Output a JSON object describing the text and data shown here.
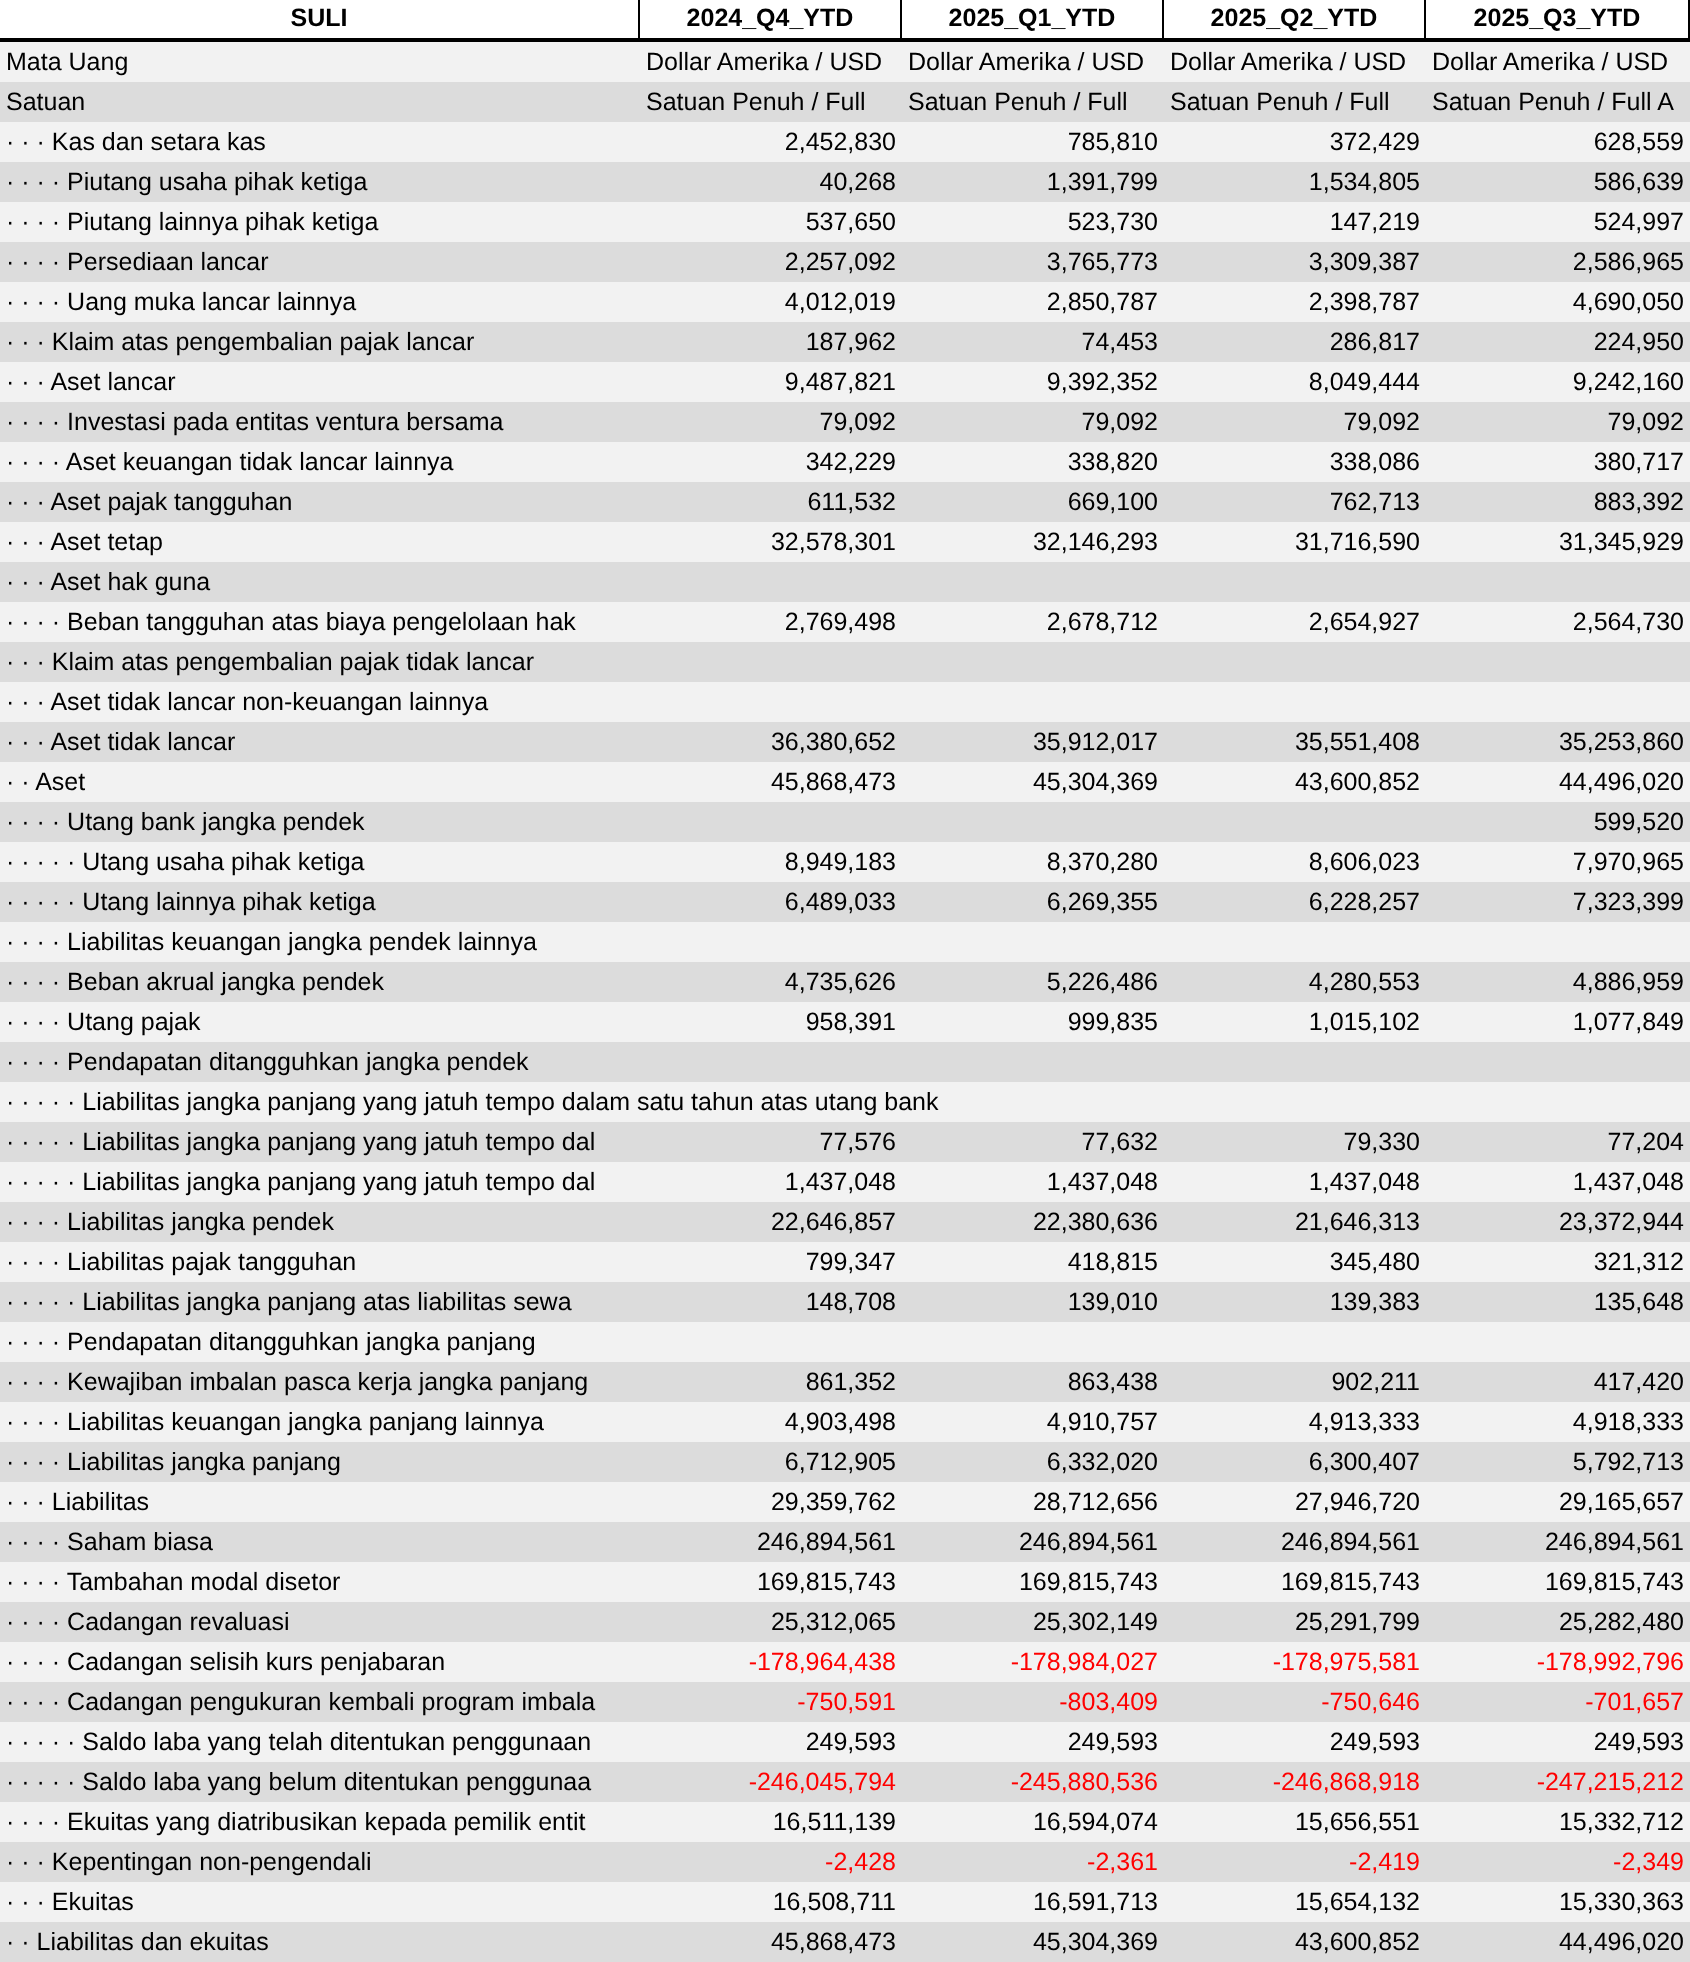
{
  "table": {
    "label_header": "SULI",
    "columns": [
      "2024_Q4_YTD",
      "2025_Q1_YTD",
      "2025_Q2_YTD",
      "2025_Q3_YTD"
    ],
    "rows": [
      {
        "label": "Mata Uang",
        "cells": [
          {
            "kind": "text",
            "text": "Dollar Amerika / USD"
          },
          {
            "kind": "text",
            "text": "Dollar Amerika / USD"
          },
          {
            "kind": "text",
            "text": "Dollar Amerika / USD"
          },
          {
            "kind": "text",
            "text": "Dollar Amerika / USD"
          }
        ]
      },
      {
        "label": "Satuan",
        "cells": [
          {
            "kind": "text",
            "text": "Satuan Penuh / Full"
          },
          {
            "kind": "text",
            "text": "Satuan Penuh / Full"
          },
          {
            "kind": "text",
            "text": "Satuan Penuh / Full"
          },
          {
            "kind": "text",
            "text": "Satuan Penuh / Full A"
          }
        ]
      },
      {
        "label": "· · · Kas dan setara kas",
        "cells": [
          {
            "kind": "amount",
            "text": "2,452,830",
            "negative": false
          },
          {
            "kind": "amount",
            "text": "785,810",
            "negative": false
          },
          {
            "kind": "amount",
            "text": "372,429",
            "negative": false
          },
          {
            "kind": "amount",
            "text": "628,559",
            "negative": false
          }
        ]
      },
      {
        "label": "· · · · Piutang usaha pihak ketiga",
        "cells": [
          {
            "kind": "amount",
            "text": "40,268",
            "negative": false
          },
          {
            "kind": "amount",
            "text": "1,391,799",
            "negative": false
          },
          {
            "kind": "amount",
            "text": "1,534,805",
            "negative": false
          },
          {
            "kind": "amount",
            "text": "586,639",
            "negative": false
          }
        ]
      },
      {
        "label": "· · · · Piutang lainnya pihak ketiga",
        "cells": [
          {
            "kind": "amount",
            "text": "537,650",
            "negative": false
          },
          {
            "kind": "amount",
            "text": "523,730",
            "negative": false
          },
          {
            "kind": "amount",
            "text": "147,219",
            "negative": false
          },
          {
            "kind": "amount",
            "text": "524,997",
            "negative": false
          }
        ]
      },
      {
        "label": "· · · · Persediaan lancar",
        "cells": [
          {
            "kind": "amount",
            "text": "2,257,092",
            "negative": false
          },
          {
            "kind": "amount",
            "text": "3,765,773",
            "negative": false
          },
          {
            "kind": "amount",
            "text": "3,309,387",
            "negative": false
          },
          {
            "kind": "amount",
            "text": "2,586,965",
            "negative": false
          }
        ]
      },
      {
        "label": "· · · · Uang muka lancar lainnya",
        "cells": [
          {
            "kind": "amount",
            "text": "4,012,019",
            "negative": false
          },
          {
            "kind": "amount",
            "text": "2,850,787",
            "negative": false
          },
          {
            "kind": "amount",
            "text": "2,398,787",
            "negative": false
          },
          {
            "kind": "amount",
            "text": "4,690,050",
            "negative": false
          }
        ]
      },
      {
        "label": "· · · Klaim atas pengembalian pajak lancar",
        "cells": [
          {
            "kind": "amount",
            "text": "187,962",
            "negative": false
          },
          {
            "kind": "amount",
            "text": "74,453",
            "negative": false
          },
          {
            "kind": "amount",
            "text": "286,817",
            "negative": false
          },
          {
            "kind": "amount",
            "text": "224,950",
            "negative": false
          }
        ]
      },
      {
        "label": "· · · Aset lancar",
        "cells": [
          {
            "kind": "amount",
            "text": "9,487,821",
            "negative": false
          },
          {
            "kind": "amount",
            "text": "9,392,352",
            "negative": false
          },
          {
            "kind": "amount",
            "text": "8,049,444",
            "negative": false
          },
          {
            "kind": "amount",
            "text": "9,242,160",
            "negative": false
          }
        ]
      },
      {
        "label": "· · · · Investasi pada entitas ventura bersama",
        "cells": [
          {
            "kind": "amount",
            "text": "79,092",
            "negative": false
          },
          {
            "kind": "amount",
            "text": "79,092",
            "negative": false
          },
          {
            "kind": "amount",
            "text": "79,092",
            "negative": false
          },
          {
            "kind": "amount",
            "text": "79,092",
            "negative": false
          }
        ]
      },
      {
        "label": "· · · · Aset keuangan tidak lancar lainnya",
        "cells": [
          {
            "kind": "amount",
            "text": "342,229",
            "negative": false
          },
          {
            "kind": "amount",
            "text": "338,820",
            "negative": false
          },
          {
            "kind": "amount",
            "text": "338,086",
            "negative": false
          },
          {
            "kind": "amount",
            "text": "380,717",
            "negative": false
          }
        ]
      },
      {
        "label": "· · · Aset pajak tangguhan",
        "cells": [
          {
            "kind": "amount",
            "text": "611,532",
            "negative": false
          },
          {
            "kind": "amount",
            "text": "669,100",
            "negative": false
          },
          {
            "kind": "amount",
            "text": "762,713",
            "negative": false
          },
          {
            "kind": "amount",
            "text": "883,392",
            "negative": false
          }
        ]
      },
      {
        "label": "· · · Aset tetap",
        "cells": [
          {
            "kind": "amount",
            "text": "32,578,301",
            "negative": false
          },
          {
            "kind": "amount",
            "text": "32,146,293",
            "negative": false
          },
          {
            "kind": "amount",
            "text": "31,716,590",
            "negative": false
          },
          {
            "kind": "amount",
            "text": "31,345,929",
            "negative": false
          }
        ]
      },
      {
        "label": "· · · Aset hak guna",
        "cells": [
          {
            "kind": "blank"
          },
          {
            "kind": "blank"
          },
          {
            "kind": "blank"
          },
          {
            "kind": "blank"
          }
        ]
      },
      {
        "label": "· · · · Beban tangguhan atas biaya pengelolaan hak",
        "cells": [
          {
            "kind": "amount",
            "text": "2,769,498",
            "negative": false
          },
          {
            "kind": "amount",
            "text": "2,678,712",
            "negative": false
          },
          {
            "kind": "amount",
            "text": "2,654,927",
            "negative": false
          },
          {
            "kind": "amount",
            "text": "2,564,730",
            "negative": false
          }
        ]
      },
      {
        "label": "· · · Klaim atas pengembalian pajak tidak lancar",
        "cells": [
          {
            "kind": "blank"
          },
          {
            "kind": "blank"
          },
          {
            "kind": "blank"
          },
          {
            "kind": "blank"
          }
        ]
      },
      {
        "label": "· · · Aset tidak lancar non-keuangan lainnya",
        "cells": [
          {
            "kind": "blank"
          },
          {
            "kind": "blank"
          },
          {
            "kind": "blank"
          },
          {
            "kind": "blank"
          }
        ]
      },
      {
        "label": "· · · Aset tidak lancar",
        "cells": [
          {
            "kind": "amount",
            "text": "36,380,652",
            "negative": false
          },
          {
            "kind": "amount",
            "text": "35,912,017",
            "negative": false
          },
          {
            "kind": "amount",
            "text": "35,551,408",
            "negative": false
          },
          {
            "kind": "amount",
            "text": "35,253,860",
            "negative": false
          }
        ]
      },
      {
        "label": "· · Aset",
        "cells": [
          {
            "kind": "amount",
            "text": "45,868,473",
            "negative": false
          },
          {
            "kind": "amount",
            "text": "45,304,369",
            "negative": false
          },
          {
            "kind": "amount",
            "text": "43,600,852",
            "negative": false
          },
          {
            "kind": "amount",
            "text": "44,496,020",
            "negative": false
          }
        ]
      },
      {
        "label": "· · · · Utang bank jangka pendek",
        "cells": [
          {
            "kind": "blank"
          },
          {
            "kind": "blank"
          },
          {
            "kind": "blank"
          },
          {
            "kind": "amount",
            "text": "599,520",
            "negative": false
          }
        ]
      },
      {
        "label": "· · · · · Utang usaha pihak ketiga",
        "cells": [
          {
            "kind": "amount",
            "text": "8,949,183",
            "negative": false
          },
          {
            "kind": "amount",
            "text": "8,370,280",
            "negative": false
          },
          {
            "kind": "amount",
            "text": "8,606,023",
            "negative": false
          },
          {
            "kind": "amount",
            "text": "7,970,965",
            "negative": false
          }
        ]
      },
      {
        "label": "· · · · · Utang lainnya pihak ketiga",
        "cells": [
          {
            "kind": "amount",
            "text": "6,489,033",
            "negative": false
          },
          {
            "kind": "amount",
            "text": "6,269,355",
            "negative": false
          },
          {
            "kind": "amount",
            "text": "6,228,257",
            "negative": false
          },
          {
            "kind": "amount",
            "text": "7,323,399",
            "negative": false
          }
        ]
      },
      {
        "label": "· · · · Liabilitas keuangan jangka pendek lainnya",
        "cells": [
          {
            "kind": "blank"
          },
          {
            "kind": "blank"
          },
          {
            "kind": "blank"
          },
          {
            "kind": "blank"
          }
        ]
      },
      {
        "label": "· · · · Beban akrual jangka pendek",
        "cells": [
          {
            "kind": "amount",
            "text": "4,735,626",
            "negative": false
          },
          {
            "kind": "amount",
            "text": "5,226,486",
            "negative": false
          },
          {
            "kind": "amount",
            "text": "4,280,553",
            "negative": false
          },
          {
            "kind": "amount",
            "text": "4,886,959",
            "negative": false
          }
        ]
      },
      {
        "label": "· · · · Utang pajak",
        "cells": [
          {
            "kind": "amount",
            "text": "958,391",
            "negative": false
          },
          {
            "kind": "amount",
            "text": "999,835",
            "negative": false
          },
          {
            "kind": "amount",
            "text": "1,015,102",
            "negative": false
          },
          {
            "kind": "amount",
            "text": "1,077,849",
            "negative": false
          }
        ]
      },
      {
        "label": "· · · · Pendapatan ditangguhkan jangka pendek",
        "cells": [
          {
            "kind": "blank"
          },
          {
            "kind": "blank"
          },
          {
            "kind": "blank"
          },
          {
            "kind": "blank"
          }
        ]
      },
      {
        "label": "· · · · · Liabilitas jangka panjang yang jatuh tempo dalam satu tahun atas utang bank",
        "cells": [
          {
            "kind": "blank"
          },
          {
            "kind": "blank"
          },
          {
            "kind": "blank"
          },
          {
            "kind": "blank"
          }
        ]
      },
      {
        "label": "· · · · · Liabilitas jangka panjang yang jatuh tempo dal",
        "cells": [
          {
            "kind": "amount",
            "text": "77,576",
            "negative": false
          },
          {
            "kind": "amount",
            "text": "77,632",
            "negative": false
          },
          {
            "kind": "amount",
            "text": "79,330",
            "negative": false
          },
          {
            "kind": "amount",
            "text": "77,204",
            "negative": false
          }
        ]
      },
      {
        "label": "· · · · · Liabilitas jangka panjang yang jatuh tempo dal",
        "cells": [
          {
            "kind": "amount",
            "text": "1,437,048",
            "negative": false
          },
          {
            "kind": "amount",
            "text": "1,437,048",
            "negative": false
          },
          {
            "kind": "amount",
            "text": "1,437,048",
            "negative": false
          },
          {
            "kind": "amount",
            "text": "1,437,048",
            "negative": false
          }
        ]
      },
      {
        "label": "· · · · Liabilitas jangka pendek",
        "cells": [
          {
            "kind": "amount",
            "text": "22,646,857",
            "negative": false
          },
          {
            "kind": "amount",
            "text": "22,380,636",
            "negative": false
          },
          {
            "kind": "amount",
            "text": "21,646,313",
            "negative": false
          },
          {
            "kind": "amount",
            "text": "23,372,944",
            "negative": false
          }
        ]
      },
      {
        "label": "· · · · Liabilitas pajak tangguhan",
        "cells": [
          {
            "kind": "amount",
            "text": "799,347",
            "negative": false
          },
          {
            "kind": "amount",
            "text": "418,815",
            "negative": false
          },
          {
            "kind": "amount",
            "text": "345,480",
            "negative": false
          },
          {
            "kind": "amount",
            "text": "321,312",
            "negative": false
          }
        ]
      },
      {
        "label": "· · · · · Liabilitas jangka panjang atas liabilitas sewa",
        "cells": [
          {
            "kind": "amount",
            "text": "148,708",
            "negative": false
          },
          {
            "kind": "amount",
            "text": "139,010",
            "negative": false
          },
          {
            "kind": "amount",
            "text": "139,383",
            "negative": false
          },
          {
            "kind": "amount",
            "text": "135,648",
            "negative": false
          }
        ]
      },
      {
        "label": "· · · · Pendapatan ditangguhkan jangka panjang",
        "cells": [
          {
            "kind": "blank"
          },
          {
            "kind": "blank"
          },
          {
            "kind": "blank"
          },
          {
            "kind": "blank"
          }
        ]
      },
      {
        "label": "· · · · Kewajiban imbalan pasca kerja jangka panjang",
        "cells": [
          {
            "kind": "amount",
            "text": "861,352",
            "negative": false
          },
          {
            "kind": "amount",
            "text": "863,438",
            "negative": false
          },
          {
            "kind": "amount",
            "text": "902,211",
            "negative": false
          },
          {
            "kind": "amount",
            "text": "417,420",
            "negative": false
          }
        ]
      },
      {
        "label": "· · · · Liabilitas keuangan jangka panjang lainnya",
        "cells": [
          {
            "kind": "amount",
            "text": "4,903,498",
            "negative": false
          },
          {
            "kind": "amount",
            "text": "4,910,757",
            "negative": false
          },
          {
            "kind": "amount",
            "text": "4,913,333",
            "negative": false
          },
          {
            "kind": "amount",
            "text": "4,918,333",
            "negative": false
          }
        ]
      },
      {
        "label": "· · · · Liabilitas jangka panjang",
        "cells": [
          {
            "kind": "amount",
            "text": "6,712,905",
            "negative": false
          },
          {
            "kind": "amount",
            "text": "6,332,020",
            "negative": false
          },
          {
            "kind": "amount",
            "text": "6,300,407",
            "negative": false
          },
          {
            "kind": "amount",
            "text": "5,792,713",
            "negative": false
          }
        ]
      },
      {
        "label": "· · · Liabilitas",
        "cells": [
          {
            "kind": "amount",
            "text": "29,359,762",
            "negative": false
          },
          {
            "kind": "amount",
            "text": "28,712,656",
            "negative": false
          },
          {
            "kind": "amount",
            "text": "27,946,720",
            "negative": false
          },
          {
            "kind": "amount",
            "text": "29,165,657",
            "negative": false
          }
        ]
      },
      {
        "label": "· · · · Saham biasa",
        "cells": [
          {
            "kind": "amount",
            "text": "246,894,561",
            "negative": false
          },
          {
            "kind": "amount",
            "text": "246,894,561",
            "negative": false
          },
          {
            "kind": "amount",
            "text": "246,894,561",
            "negative": false
          },
          {
            "kind": "amount",
            "text": "246,894,561",
            "negative": false
          }
        ]
      },
      {
        "label": "· · · · Tambahan modal disetor",
        "cells": [
          {
            "kind": "amount",
            "text": "169,815,743",
            "negative": false
          },
          {
            "kind": "amount",
            "text": "169,815,743",
            "negative": false
          },
          {
            "kind": "amount",
            "text": "169,815,743",
            "negative": false
          },
          {
            "kind": "amount",
            "text": "169,815,743",
            "negative": false
          }
        ]
      },
      {
        "label": "· · · · Cadangan revaluasi",
        "cells": [
          {
            "kind": "amount",
            "text": "25,312,065",
            "negative": false
          },
          {
            "kind": "amount",
            "text": "25,302,149",
            "negative": false
          },
          {
            "kind": "amount",
            "text": "25,291,799",
            "negative": false
          },
          {
            "kind": "amount",
            "text": "25,282,480",
            "negative": false
          }
        ]
      },
      {
        "label": "· · · · Cadangan selisih kurs penjabaran",
        "cells": [
          {
            "kind": "amount",
            "text": "-178,964,438",
            "negative": true
          },
          {
            "kind": "amount",
            "text": "-178,984,027",
            "negative": true
          },
          {
            "kind": "amount",
            "text": "-178,975,581",
            "negative": true
          },
          {
            "kind": "amount",
            "text": "-178,992,796",
            "negative": true
          }
        ]
      },
      {
        "label": "· · · · Cadangan pengukuran kembali program imbala",
        "cells": [
          {
            "kind": "amount",
            "text": "-750,591",
            "negative": true
          },
          {
            "kind": "amount",
            "text": "-803,409",
            "negative": true
          },
          {
            "kind": "amount",
            "text": "-750,646",
            "negative": true
          },
          {
            "kind": "amount",
            "text": "-701,657",
            "negative": true
          }
        ]
      },
      {
        "label": "· · · · · Saldo laba yang telah ditentukan penggunaan",
        "cells": [
          {
            "kind": "amount",
            "text": "249,593",
            "negative": false
          },
          {
            "kind": "amount",
            "text": "249,593",
            "negative": false
          },
          {
            "kind": "amount",
            "text": "249,593",
            "negative": false
          },
          {
            "kind": "amount",
            "text": "249,593",
            "negative": false
          }
        ]
      },
      {
        "label": "· · · · · Saldo laba yang belum ditentukan penggunaa",
        "cells": [
          {
            "kind": "amount",
            "text": "-246,045,794",
            "negative": true
          },
          {
            "kind": "amount",
            "text": "-245,880,536",
            "negative": true
          },
          {
            "kind": "amount",
            "text": "-246,868,918",
            "negative": true
          },
          {
            "kind": "amount",
            "text": "-247,215,212",
            "negative": true
          }
        ]
      },
      {
        "label": "· · · · Ekuitas yang diatribusikan kepada pemilik entit",
        "cells": [
          {
            "kind": "amount",
            "text": "16,511,139",
            "negative": false
          },
          {
            "kind": "amount",
            "text": "16,594,074",
            "negative": false
          },
          {
            "kind": "amount",
            "text": "15,656,551",
            "negative": false
          },
          {
            "kind": "amount",
            "text": "15,332,712",
            "negative": false
          }
        ]
      },
      {
        "label": "· · · Kepentingan non-pengendali",
        "cells": [
          {
            "kind": "amount",
            "text": "-2,428",
            "negative": true
          },
          {
            "kind": "amount",
            "text": "-2,361",
            "negative": true
          },
          {
            "kind": "amount",
            "text": "-2,419",
            "negative": true
          },
          {
            "kind": "amount",
            "text": "-2,349",
            "negative": true
          }
        ]
      },
      {
        "label": "· · · Ekuitas",
        "cells": [
          {
            "kind": "amount",
            "text": "16,508,711",
            "negative": false
          },
          {
            "kind": "amount",
            "text": "16,591,713",
            "negative": false
          },
          {
            "kind": "amount",
            "text": "15,654,132",
            "negative": false
          },
          {
            "kind": "amount",
            "text": "15,330,363",
            "negative": false
          }
        ]
      },
      {
        "label": "· · Liabilitas dan ekuitas",
        "cells": [
          {
            "kind": "amount",
            "text": "45,868,473",
            "negative": false
          },
          {
            "kind": "amount",
            "text": "45,304,369",
            "negative": false
          },
          {
            "kind": "amount",
            "text": "43,600,852",
            "negative": false
          },
          {
            "kind": "amount",
            "text": "44,496,020",
            "negative": false
          }
        ]
      }
    ]
  }
}
